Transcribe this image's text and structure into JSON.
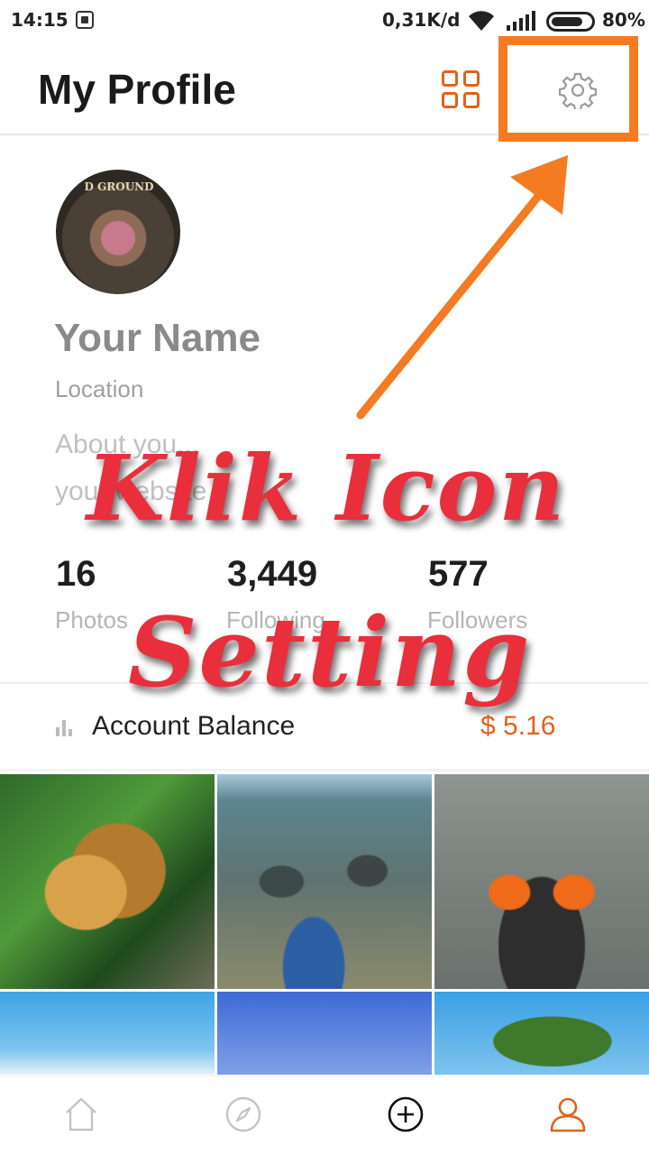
{
  "status_bar": {
    "time": "14:15",
    "network_speed": "0,31K/d",
    "battery_percent": "80%",
    "battery_level": 0.8,
    "icons": [
      "bbm-icon",
      "wifi-icon",
      "signal-icon",
      "battery-icon"
    ]
  },
  "header": {
    "title": "My Profile",
    "grid_icon": "grid-view-icon",
    "settings_icon": "gear-icon"
  },
  "profile": {
    "avatar_sign_text": "D GROUND",
    "name": "Your Name",
    "location": "Location",
    "about_line1": "About you...",
    "about_line2": "your website"
  },
  "stats": [
    {
      "value": "16",
      "label": "Photos"
    },
    {
      "value": "3,449",
      "label": "Following"
    },
    {
      "value": "577",
      "label": "Followers"
    }
  ],
  "balance": {
    "label": "Account Balance",
    "value": "$ 5.16",
    "icon": "bar-chart-icon"
  },
  "photos": [
    "photo-food-on-banana-leaf",
    "photo-rocky-beach",
    "photo-rafting",
    "photo-sky-1",
    "photo-sky-2",
    "photo-rock-island"
  ],
  "bottom_nav": {
    "items": [
      {
        "icon": "home-icon",
        "active": false
      },
      {
        "icon": "compass-icon",
        "active": false
      },
      {
        "icon": "add-circle-icon",
        "active": false
      },
      {
        "icon": "profile-icon",
        "active": true
      }
    ]
  },
  "annotation": {
    "line1": "Klik Icon",
    "line2": "Setting",
    "color": "#e92f3b",
    "arrow_color": "#f47b22"
  },
  "colors": {
    "accent": "#e1621b",
    "highlight": "#f47b22"
  }
}
